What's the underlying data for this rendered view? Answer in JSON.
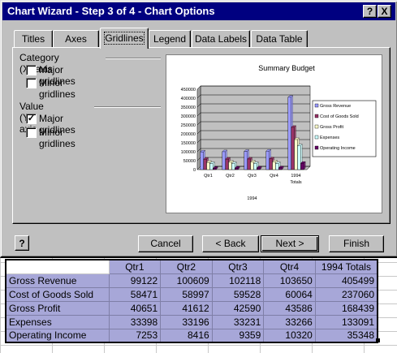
{
  "window": {
    "title": "Chart Wizard - Step 3 of 4 - Chart Options",
    "help_btn": "?",
    "close_btn": "X"
  },
  "tabs": [
    {
      "label": "Titles"
    },
    {
      "label": "Axes"
    },
    {
      "label": "Gridlines"
    },
    {
      "label": "Legend"
    },
    {
      "label": "Data Labels"
    },
    {
      "label": "Data Table"
    }
  ],
  "active_tab": "Gridlines",
  "gridlines": {
    "category_title": "Category (X) axis",
    "value_title": "Value (Y) axis",
    "major_label": "Major gridlines",
    "minor_label": "Minor gridlines",
    "cat_major_checked": false,
    "cat_minor_checked": false,
    "val_major_checked": true,
    "val_minor_checked": false,
    "check_mark": "✓"
  },
  "chart_data": {
    "type": "bar",
    "title": "Summary Budget",
    "categories": [
      "Qtr1",
      "Qtr2",
      "Qtr3",
      "Qtr4",
      "1994 Totals"
    ],
    "category_display": [
      "Qtr1",
      "Qtr2",
      "Qtr3",
      "Qtr4",
      "1994",
      "Totals"
    ],
    "xlabel": "1994",
    "ylim": [
      0,
      450000
    ],
    "yticks": [
      "0",
      "50000",
      "100000",
      "150000",
      "200000",
      "250000",
      "300000",
      "350000",
      "400000",
      "450000"
    ],
    "grid": "major-y",
    "legend_position": "right",
    "series": [
      {
        "name": "Gross Revenue",
        "color": "#9999ff",
        "values": [
          99122,
          100609,
          102118,
          103650,
          405499
        ]
      },
      {
        "name": "Cost of Goods Sold",
        "color": "#993366",
        "values": [
          58471,
          58997,
          59528,
          60064,
          237060
        ]
      },
      {
        "name": "Gross Profit",
        "color": "#ffffcc",
        "values": [
          40651,
          41612,
          42590,
          43586,
          168439
        ]
      },
      {
        "name": "Expenses",
        "color": "#ccffff",
        "values": [
          33398,
          33196,
          33231,
          33266,
          133091
        ]
      },
      {
        "name": "Operating Income",
        "color": "#660066",
        "values": [
          7253,
          8416,
          9359,
          10320,
          35348
        ]
      }
    ]
  },
  "buttons": {
    "help": "?",
    "cancel": "Cancel",
    "back": "< Back",
    "next": "Next >",
    "finish": "Finish"
  },
  "table": {
    "headers": [
      "Qtr1",
      "Qtr2",
      "Qtr3",
      "Qtr4",
      "1994 Totals"
    ],
    "rows": [
      {
        "label": "Gross Revenue",
        "values": [
          "99122",
          "100609",
          "102118",
          "103650",
          "405499"
        ]
      },
      {
        "label": "Cost of Goods Sold",
        "values": [
          "58471",
          "58997",
          "59528",
          "60064",
          "237060"
        ]
      },
      {
        "label": "Gross Profit",
        "values": [
          "40651",
          "41612",
          "42590",
          "43586",
          "168439"
        ]
      },
      {
        "label": "Expenses",
        "values": [
          "33398",
          "33196",
          "33231",
          "33266",
          "133091"
        ]
      },
      {
        "label": "Operating Income",
        "values": [
          "7253",
          "8416",
          "9359",
          "10320",
          "35348"
        ]
      }
    ]
  }
}
